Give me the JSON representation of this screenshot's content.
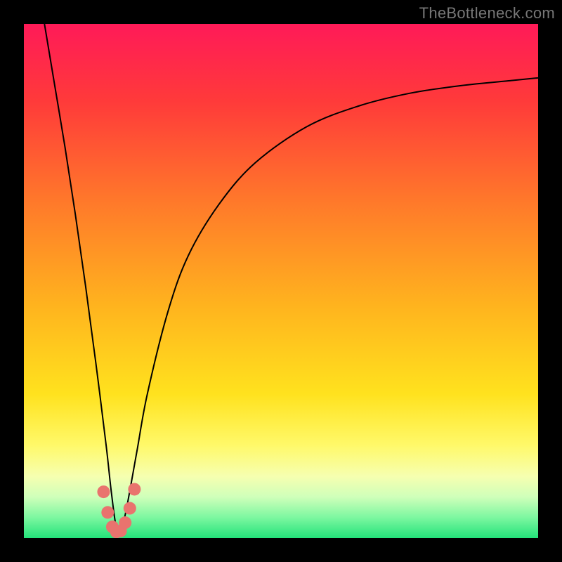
{
  "watermark": "TheBottleneck.com",
  "colors": {
    "frame": "#000000",
    "gradient_stops": [
      {
        "offset": 0.0,
        "color": "#ff1a58"
      },
      {
        "offset": 0.15,
        "color": "#ff3a3a"
      },
      {
        "offset": 0.35,
        "color": "#ff7a2a"
      },
      {
        "offset": 0.55,
        "color": "#ffb41e"
      },
      {
        "offset": 0.72,
        "color": "#ffe21e"
      },
      {
        "offset": 0.82,
        "color": "#fff96a"
      },
      {
        "offset": 0.88,
        "color": "#f6ffb0"
      },
      {
        "offset": 0.92,
        "color": "#cfffba"
      },
      {
        "offset": 0.96,
        "color": "#7cf7a0"
      },
      {
        "offset": 1.0,
        "color": "#23e27a"
      }
    ],
    "curve": "#000000",
    "marker": "#e9736e"
  },
  "chart_data": {
    "type": "line",
    "title": "",
    "xlabel": "",
    "ylabel": "",
    "xlim": [
      0,
      100
    ],
    "ylim": [
      0,
      100
    ],
    "note": "Axes are unlabeled in the source image; x and y values are estimated as percentages of the plot area width/height. The curve is a V-shaped bottleneck curve descending steeply from top-left to a minimum near x≈18 (y≈0) then rising asymptotically toward the right.",
    "series": [
      {
        "name": "bottleneck-curve",
        "x": [
          4,
          6,
          8,
          10,
          12,
          14,
          16,
          17,
          18,
          19,
          20,
          22,
          24,
          28,
          32,
          38,
          45,
          55,
          65,
          75,
          85,
          95,
          100
        ],
        "y": [
          100,
          88,
          76,
          63,
          49,
          34,
          18,
          9,
          2,
          2,
          6,
          17,
          28,
          44,
          55,
          65,
          73,
          80,
          84,
          86.5,
          88,
          89,
          89.5
        ]
      }
    ],
    "markers": {
      "name": "highlight-points",
      "x": [
        15.5,
        16.3,
        17.2,
        18.0,
        18.8,
        19.7,
        20.6,
        21.5
      ],
      "y": [
        9.0,
        5.0,
        2.2,
        1.2,
        1.4,
        3.0,
        5.8,
        9.5
      ]
    }
  }
}
